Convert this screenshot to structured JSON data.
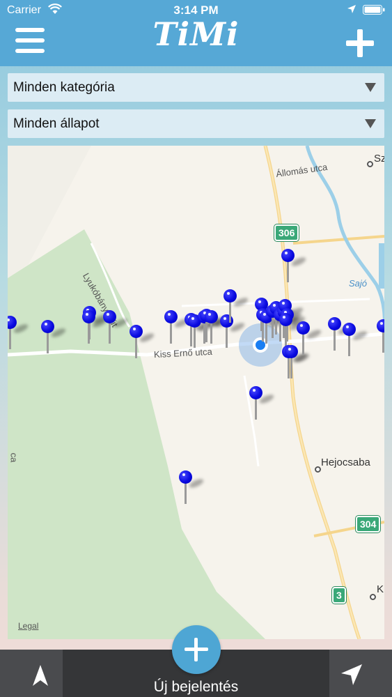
{
  "status_bar": {
    "carrier": "Carrier",
    "time": "3:14 PM"
  },
  "header": {
    "logo": "TiMi"
  },
  "filters": {
    "category": {
      "selected": "Minden kategória"
    },
    "status": {
      "selected": "Minden állapot"
    }
  },
  "map": {
    "streets": {
      "allomas": "Állomás utca",
      "lyukobanyai": "Lyukóbányai út",
      "kiss_erno": "Kiss Ernő utca",
      "ca": "ca"
    },
    "river": "Sajó",
    "places": {
      "hejocsaba": "Hejocsaba",
      "sz": "Sz",
      "k": "K"
    },
    "road_shields": [
      "306",
      "304",
      "3"
    ],
    "legal": "Legal",
    "pin_color": "#0000e0",
    "pin_count": 28
  },
  "bottom_bar": {
    "report_label": "Új bejelentés",
    "left_icon": "north-arrow-icon",
    "right_icon": "location-arrow-icon"
  },
  "colors": {
    "header": "#56a8d6",
    "select_bg": "#dcecf4",
    "bottom_bar": "#353638",
    "fab": "#4ea6d4"
  }
}
